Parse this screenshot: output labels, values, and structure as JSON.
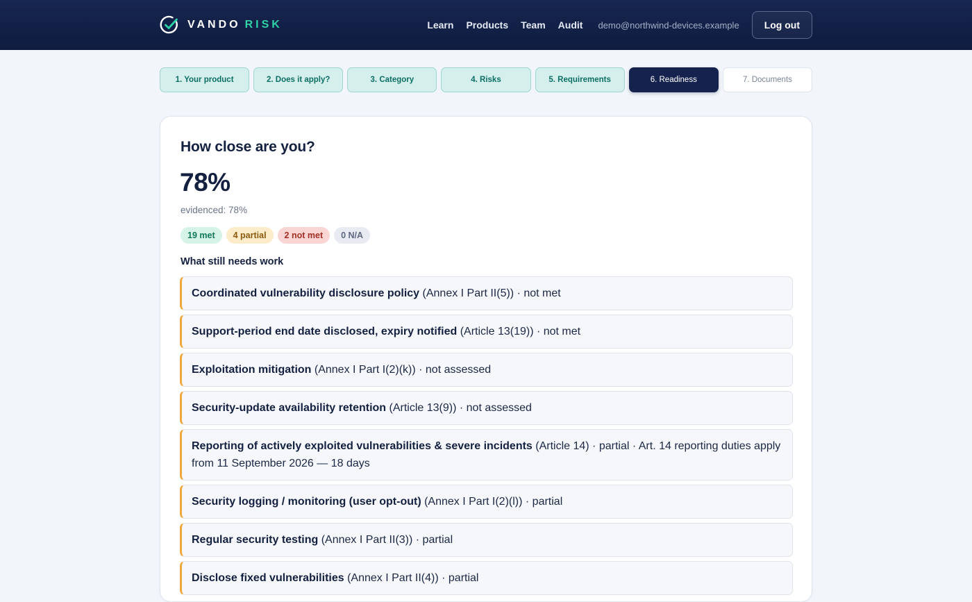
{
  "brand": {
    "name": "VANDO",
    "accent": "RISK"
  },
  "nav": {
    "links": [
      "Learn",
      "Products",
      "Team",
      "Audit"
    ],
    "email": "demo@northwind-devices.example",
    "logout_label": "Log out"
  },
  "steps": [
    {
      "label": "1. Your product",
      "state": "done"
    },
    {
      "label": "2. Does it apply?",
      "state": "done"
    },
    {
      "label": "3. Category",
      "state": "done"
    },
    {
      "label": "4. Risks",
      "state": "done"
    },
    {
      "label": "5. Requirements",
      "state": "done"
    },
    {
      "label": "6. Readiness",
      "state": "active"
    },
    {
      "label": "7. Documents",
      "state": "todo"
    }
  ],
  "readiness": {
    "title": "How close are you?",
    "percent": "78%",
    "evidenced": "evidenced: 78%",
    "badges": {
      "met": "19 met",
      "partial": "4 partial",
      "not_met": "2 not met",
      "na": "0 N/A"
    },
    "section_title": "What still needs work",
    "items": [
      {
        "name": "Coordinated vulnerability disclosure policy",
        "detail": " (Annex I Part II(5)) · not met"
      },
      {
        "name": "Support-period end date disclosed, expiry notified",
        "detail": " (Article 13(19)) · not met"
      },
      {
        "name": "Exploitation mitigation",
        "detail": " (Annex I Part I(2)(k)) · not assessed"
      },
      {
        "name": "Security-update availability retention",
        "detail": " (Article 13(9)) · not assessed"
      },
      {
        "name": "Reporting of actively exploited vulnerabilities & severe incidents",
        "detail": " (Article 14) · partial · Art. 14 reporting duties apply from 11 September 2026 — 18 days"
      },
      {
        "name": "Security logging / monitoring (user opt-out)",
        "detail": " (Annex I Part I(2)(l)) · partial"
      },
      {
        "name": "Regular security testing",
        "detail": " (Annex I Part II(3)) · partial"
      },
      {
        "name": "Disclose fixed vulnerabilities",
        "detail": " (Annex I Part II(4)) · partial"
      }
    ]
  },
  "colors": {
    "header_bg": "#16224e",
    "accent": "#2fd1a6",
    "item_border": "#f0a83c"
  }
}
